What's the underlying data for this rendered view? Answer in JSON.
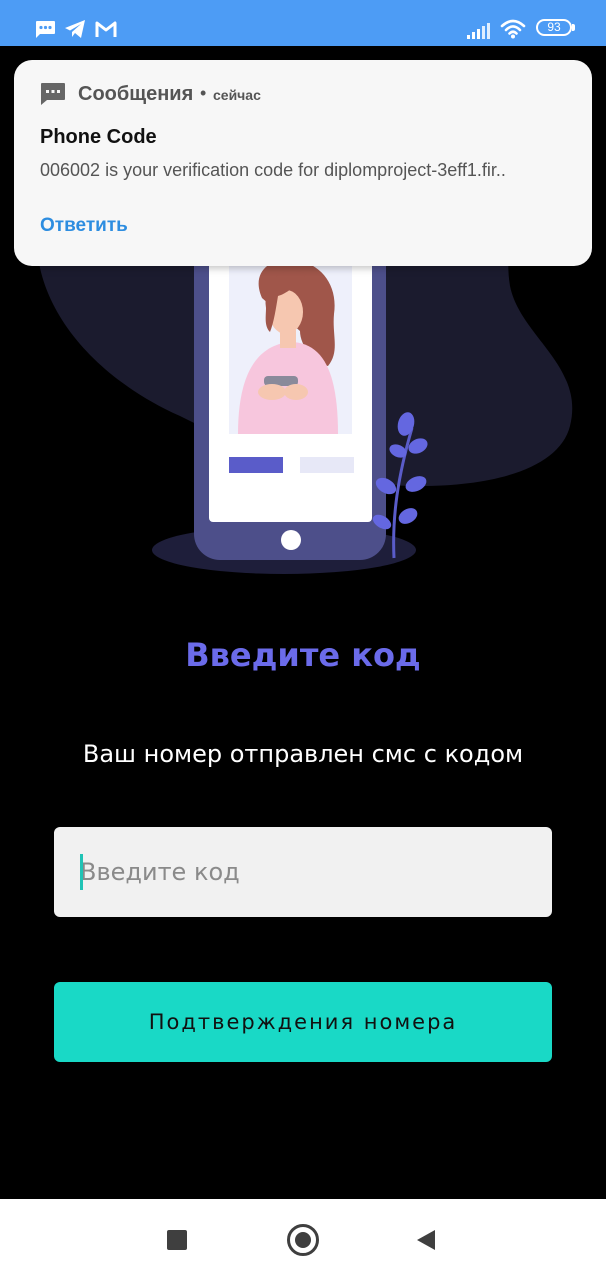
{
  "status_bar": {
    "battery_level": "93",
    "left_icons": [
      "messages-icon",
      "telegram-icon",
      "gmail-icon"
    ],
    "right_icons": [
      "signal-icon",
      "wifi-icon",
      "battery-icon"
    ]
  },
  "notification": {
    "app_name": "Сообщения",
    "separator": "•",
    "time": "сейчас",
    "title": "Phone Code",
    "body": "006002 is your verification code for diplomproject-3eff1.fir..",
    "reply_label": "Ответить"
  },
  "screen": {
    "heading": "Введите код",
    "subheading": "Ваш номер отправлен смс с кодом",
    "code_input": {
      "value": "",
      "placeholder": "Введите код"
    },
    "confirm_button_label": "Подтверждения номера"
  },
  "nav_bar": {
    "buttons": [
      "recent-apps",
      "home",
      "back"
    ]
  },
  "colors": {
    "status_bar": "#4d9cf5",
    "background": "#000000",
    "accent": "#6b6bea",
    "button": "#19d9c6",
    "notification_link": "#2d8de0"
  }
}
